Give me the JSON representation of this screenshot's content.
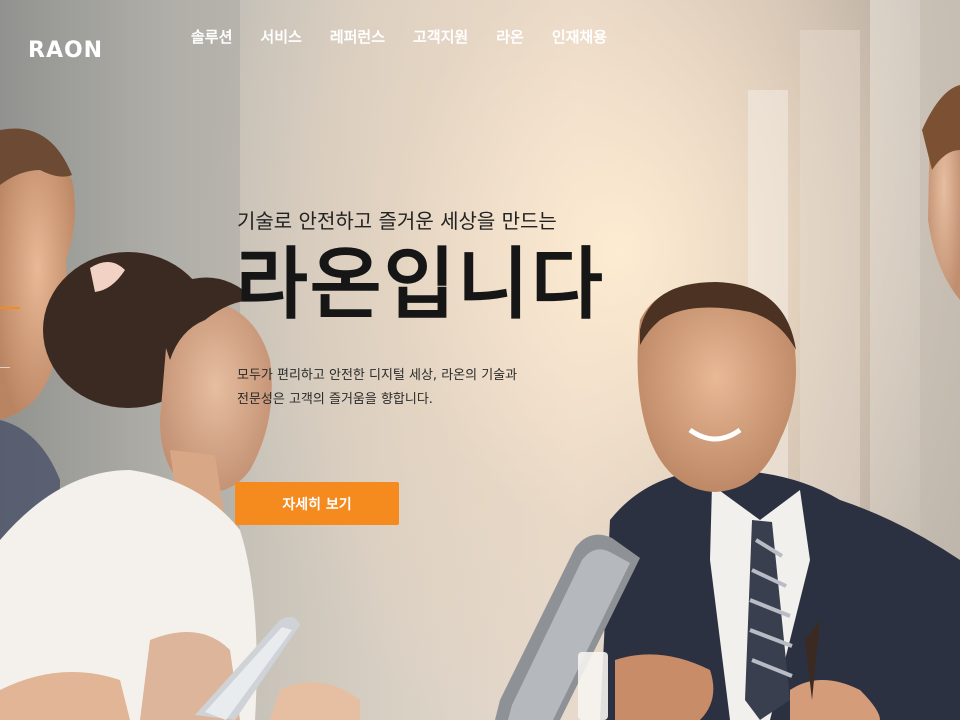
{
  "brand": {
    "logo_text": "RAON"
  },
  "nav": {
    "items": [
      "솔루션",
      "서비스",
      "레퍼런스",
      "고객지원",
      "라온",
      "인재채용"
    ]
  },
  "hero": {
    "subtitle": "기술로 안전하고 즐거운 세상을 만드는",
    "title": "라온입니다",
    "description_line1": "모두가 편리하고 안전한 디지털 세상, 라온의 기술과",
    "description_line2": "전문성은 고객의 즐거움을 향합니다.",
    "cta_label": "자세히 보기"
  },
  "colors": {
    "accent": "#f58a1f",
    "text_dark": "#161616",
    "nav_text": "#ffffff"
  }
}
